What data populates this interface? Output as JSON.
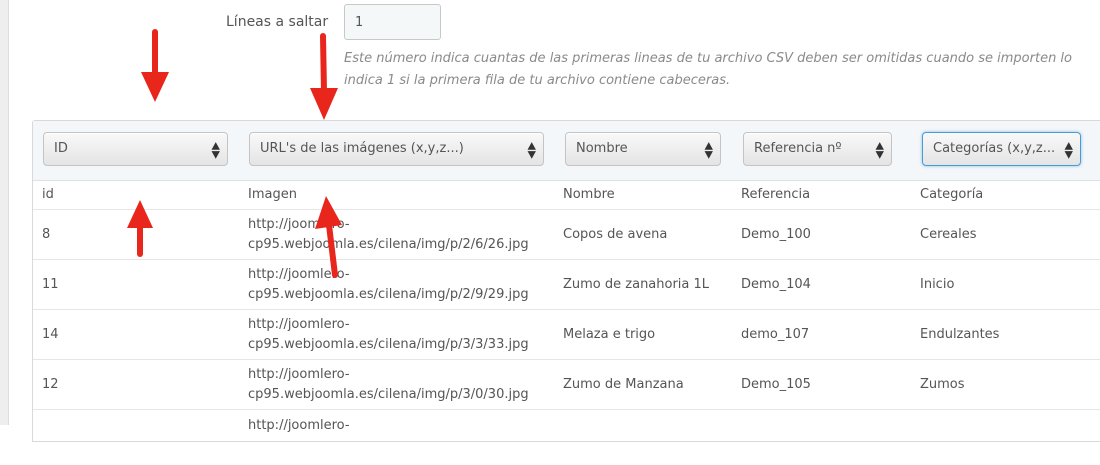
{
  "skip_lines": {
    "label": "Líneas a saltar",
    "value": "1",
    "help_line1": "Este número indica cuantas de las primeras lineas de tu archivo CSV deben ser omitidas cuando se importen lo",
    "help_line2": "indica 1 si la primera fila de tu archivo contiene cabeceras."
  },
  "mapping_selects": [
    "ID",
    "URL's de las imágenes (x,y,z...)",
    "Nombre",
    "Referencia nº",
    "Categorías (x,y,z..."
  ],
  "columns": [
    "id",
    "Imagen",
    "Nombre",
    "Referencia",
    "Categoría"
  ],
  "rows": [
    {
      "id": "8",
      "img_line1": "http://joomlero-",
      "img_line2": "cp95.webjoomla.es/cilena/img/p/2/6/26.jpg",
      "nombre": "Copos de avena",
      "referencia": "Demo_100",
      "categoria": "Cereales"
    },
    {
      "id": "11",
      "img_line1": "http://joomlero-",
      "img_line2": "cp95.webjoomla.es/cilena/img/p/2/9/29.jpg",
      "nombre": "Zumo de zanahoria 1L",
      "referencia": "Demo_104",
      "categoria": "Inicio"
    },
    {
      "id": "14",
      "img_line1": "http://joomlero-",
      "img_line2": "cp95.webjoomla.es/cilena/img/p/3/3/33.jpg",
      "nombre": "Melaza e trigo",
      "referencia": "demo_107",
      "categoria": "Endulzantes"
    },
    {
      "id": "12",
      "img_line1": "http://joomlero-",
      "img_line2": "cp95.webjoomla.es/cilena/img/p/3/0/30.jpg",
      "nombre": "Zumo de Manzana",
      "referencia": "Demo_105",
      "categoria": "Zumos"
    },
    {
      "id": "",
      "img_line1": "http://joomlero-",
      "img_line2": "",
      "nombre": "",
      "referencia": "",
      "categoria": ""
    }
  ],
  "colors": {
    "accent": "#4a9ad4",
    "arrow": "#e8261c"
  },
  "icons": {
    "select_arrows": "updown-arrows-icon",
    "annotation": "red-arrow-icon"
  }
}
